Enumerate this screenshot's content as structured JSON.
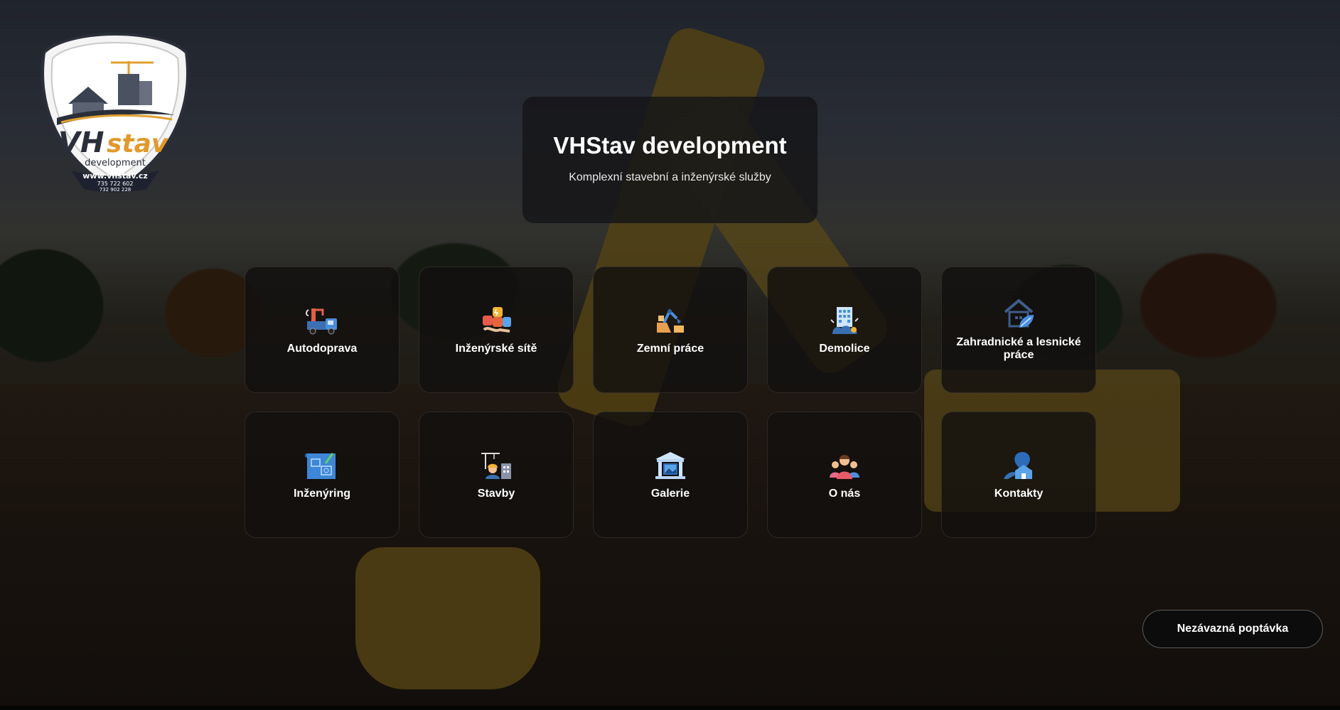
{
  "brand": {
    "logo_primary": "VH",
    "logo_accent": "stav",
    "logo_sub": "development",
    "logo_web": "www.vhstav.cz",
    "logo_phone1": "735 722 602",
    "logo_phone2": "732 902 228"
  },
  "hero": {
    "title": "VHStav development",
    "subtitle": "Komplexní stavební a inženýrské služby"
  },
  "services": [
    {
      "label": "Autodoprava",
      "icon": "truck-crane-icon"
    },
    {
      "label": "Inženýrské sítě",
      "icon": "utilities-icon"
    },
    {
      "label": "Zemní práce",
      "icon": "excavator-icon"
    },
    {
      "label": "Demolice",
      "icon": "demolition-building-icon"
    },
    {
      "label": "Zahradnické a lesnické práce",
      "icon": "house-leaf-icon"
    },
    {
      "label": "Inženýring",
      "icon": "blueprint-icon"
    },
    {
      "label": "Stavby",
      "icon": "construction-worker-icon"
    },
    {
      "label": "Galerie",
      "icon": "gallery-icon"
    },
    {
      "label": "O nás",
      "icon": "team-icon"
    },
    {
      "label": "Kontakty",
      "icon": "map-pin-home-icon"
    }
  ],
  "cta": {
    "label": "Nezávazná poptávka"
  },
  "colors": {
    "accent": "#e8a33c",
    "card_bg": "#12100f",
    "cta_bg": "#0c0c0d"
  }
}
